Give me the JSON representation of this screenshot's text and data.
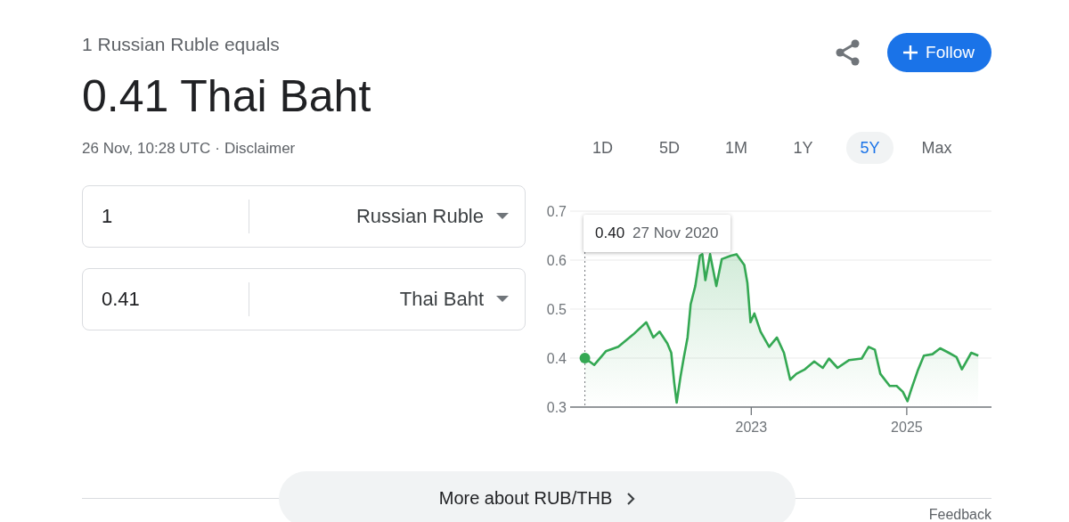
{
  "header": {
    "subtitle": "1 Russian Ruble equals",
    "result": "0.41 Thai Baht",
    "timestamp": "26 Nov, 10:28 UTC",
    "separator": "·",
    "disclaimer": "Disclaimer"
  },
  "actions": {
    "follow": "Follow"
  },
  "converter": [
    {
      "amount": "1",
      "currency": "Russian Ruble"
    },
    {
      "amount": "0.41",
      "currency": "Thai Baht"
    }
  ],
  "ranges": [
    {
      "label": "1D",
      "selected": false
    },
    {
      "label": "5D",
      "selected": false
    },
    {
      "label": "1M",
      "selected": false
    },
    {
      "label": "1Y",
      "selected": false
    },
    {
      "label": "5Y",
      "selected": true
    },
    {
      "label": "Max",
      "selected": false
    }
  ],
  "chart": {
    "tooltip": {
      "value": "0.40",
      "date": "27 Nov 2020"
    },
    "chart_data": {
      "type": "area",
      "x": [
        2020.86,
        2020.98,
        2021.13,
        2021.29,
        2021.48,
        2021.65,
        2021.74,
        2021.82,
        2021.92,
        2021.97,
        2022.01,
        2022.04,
        2022.09,
        2022.13,
        2022.18,
        2022.22,
        2022.28,
        2022.34,
        2022.37,
        2022.41,
        2022.47,
        2022.55,
        2022.62,
        2022.74,
        2022.81,
        2022.91,
        2022.95,
        2022.99,
        2023.04,
        2023.12,
        2023.23,
        2023.33,
        2023.42,
        2023.5,
        2023.58,
        2023.69,
        2023.81,
        2023.92,
        2024.0,
        2024.11,
        2024.26,
        2024.42,
        2024.51,
        2024.59,
        2024.66,
        2024.78,
        2024.87,
        2024.95,
        2025.01,
        2025.06,
        2025.14,
        2025.22,
        2025.33,
        2025.43,
        2025.54,
        2025.64,
        2025.71,
        2025.83,
        2025.92
      ],
      "series": [
        {
          "color": "#34a853",
          "values": [
            0.4,
            0.386,
            0.414,
            0.423,
            0.448,
            0.473,
            0.442,
            0.454,
            0.43,
            0.411,
            0.349,
            0.309,
            0.362,
            0.399,
            0.442,
            0.51,
            0.547,
            0.609,
            0.612,
            0.559,
            0.612,
            0.547,
            0.602,
            0.609,
            0.612,
            0.59,
            0.553,
            0.473,
            0.491,
            0.454,
            0.423,
            0.442,
            0.411,
            0.356,
            0.368,
            0.377,
            0.393,
            0.38,
            0.399,
            0.38,
            0.396,
            0.399,
            0.423,
            0.417,
            0.368,
            0.343,
            0.343,
            0.331,
            0.312,
            0.337,
            0.374,
            0.405,
            0.408,
            0.42,
            0.411,
            0.402,
            0.377,
            0.411,
            0.405
          ]
        }
      ],
      "xlim": [
        2020.67,
        2026.09
      ],
      "ylim": [
        0.3,
        0.7
      ],
      "grid": true,
      "ref_lines": [
        {
          "axis": "x",
          "value": 2020.86
        }
      ],
      "xticks": [
        2023,
        2025
      ],
      "yticks": [
        0.3,
        0.4,
        0.5,
        0.6,
        0.7
      ]
    }
  },
  "footer": {
    "more": "More about RUB/THB",
    "feedback": "Feedback"
  }
}
